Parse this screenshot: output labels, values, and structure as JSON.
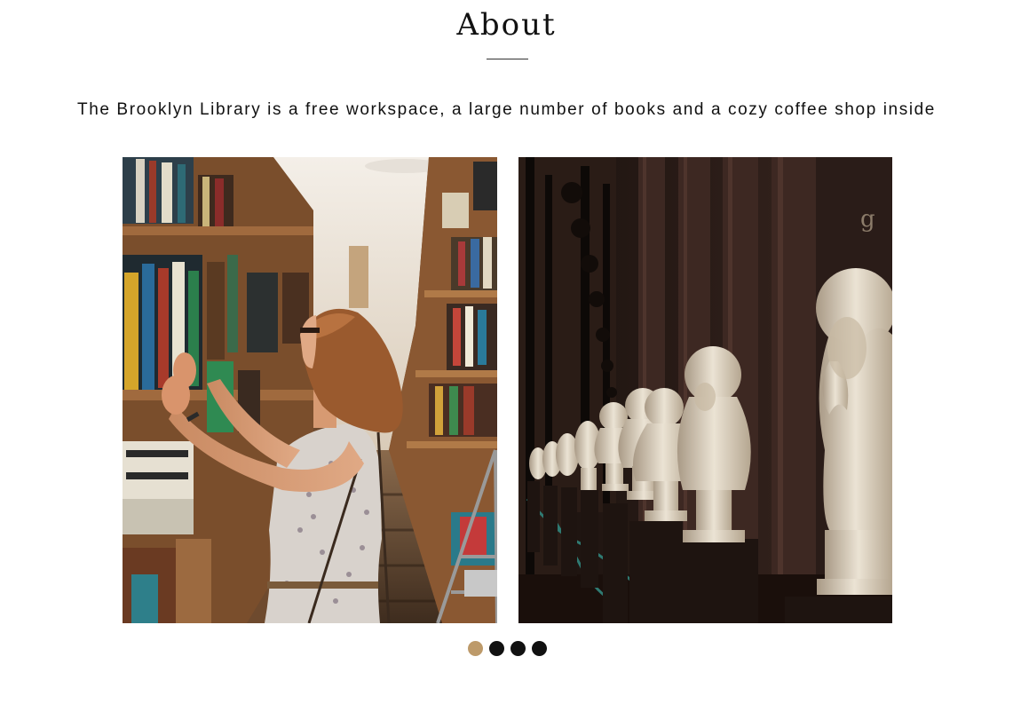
{
  "section": {
    "title": "About",
    "lead": "The Brooklyn Library is a free workspace, a large number of books and a cozy coffee shop inside"
  },
  "gallery": {
    "images": [
      {
        "name": "woman-browsing-bookshelf"
      },
      {
        "name": "library-marble-busts"
      }
    ],
    "pagination": {
      "count": 4,
      "active_index": 0,
      "active_color": "#bd9a6a",
      "inactive_color": "#111111"
    }
  }
}
